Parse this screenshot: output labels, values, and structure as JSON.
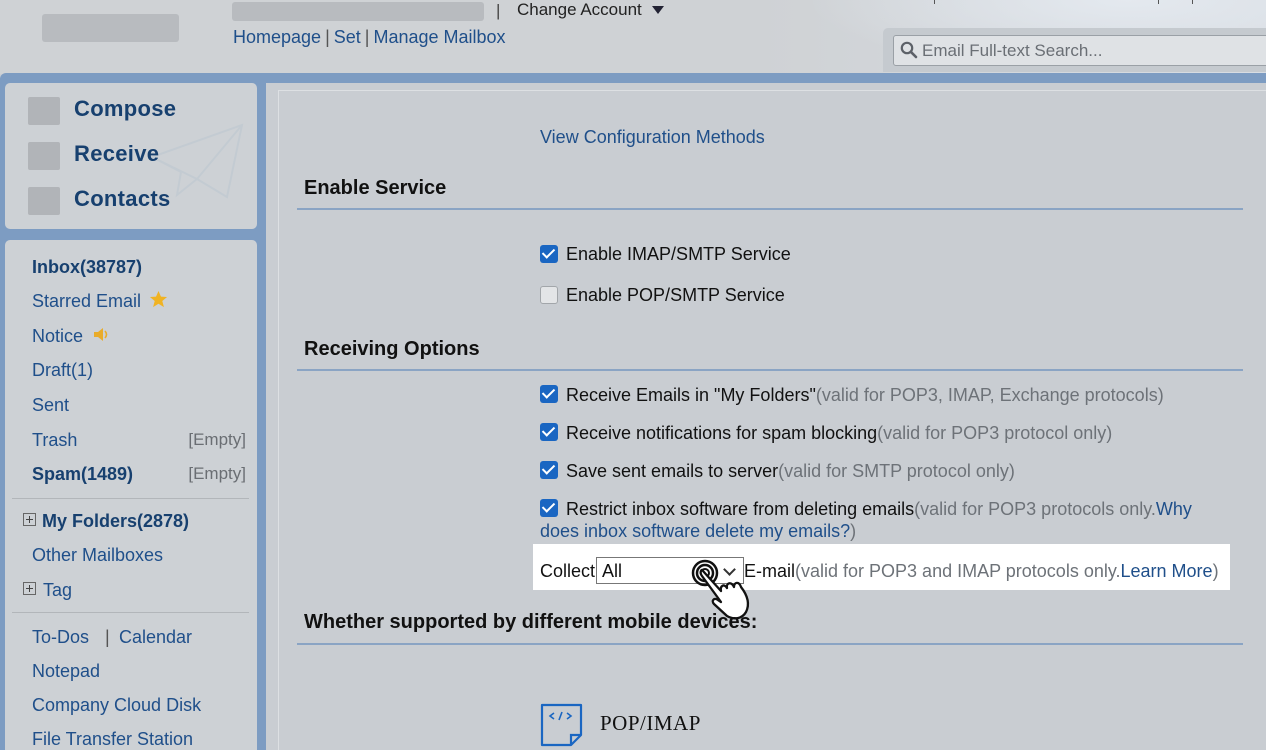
{
  "header": {
    "separator": "|",
    "change_account": "Change Account",
    "links": [
      "Homepage",
      "Set",
      "Manage Mailbox"
    ],
    "search_placeholder": "Email Full-text Search..."
  },
  "sidebar": {
    "actions": [
      "Compose",
      "Receive",
      "Contacts"
    ],
    "folders": {
      "inbox": "Inbox(38787)",
      "starred": "Starred Email",
      "notice": "Notice",
      "draft": "Draft(1)",
      "sent": "Sent",
      "trash": "Trash",
      "trash_aux": "[Empty]",
      "spam": "Spam(1489)",
      "spam_aux": "[Empty]",
      "my_folders": "My Folders(2878)",
      "other_mailboxes": "Other Mailboxes",
      "tag": "Tag",
      "todos": "To-Dos",
      "tools_separator": "|",
      "calendar": "Calendar",
      "notepad": "Notepad",
      "cloud_disk": "Company Cloud Disk",
      "file_transfer": "File Transfer Station"
    }
  },
  "main": {
    "view_config": "View Configuration Methods",
    "enable_service": {
      "title": "Enable Service",
      "options": [
        {
          "label": "Enable IMAP/SMTP Service",
          "checked": true
        },
        {
          "label": "Enable POP/SMTP Service",
          "checked": false
        }
      ]
    },
    "receiving_options": {
      "title": "Receiving Options",
      "options": [
        {
          "label": "Receive Emails in \"My Folders\"",
          "note": "(valid for POP3, IMAP, Exchange protocols)",
          "checked": true
        },
        {
          "label": "Receive notifications for spam blocking",
          "note": "(valid for POP3 protocol only)",
          "checked": true
        },
        {
          "label": "Save sent emails to server",
          "note": "(valid for SMTP protocol only)",
          "checked": true
        },
        {
          "label": "Restrict inbox software from deleting emails",
          "note": "(valid for POP3 protocols only.",
          "link": "Why does inbox software delete my emails?",
          "note_end": ")",
          "checked": true
        }
      ],
      "collect": {
        "label": "Collect",
        "value": "All",
        "suffix": "E-mail",
        "note": "(valid for POP3 and IMAP protocols only.",
        "link": "Learn More",
        "note_end": ")"
      }
    },
    "mobile": {
      "title": "Whether supported by different mobile devices:",
      "protocol": "POP/IMAP"
    }
  },
  "colors": {
    "frame_blue": "#7d9cc2",
    "link_blue": "#1f4f8a",
    "checkbox_blue": "#1a66c2",
    "panel_gray": "#cdd1d5"
  }
}
